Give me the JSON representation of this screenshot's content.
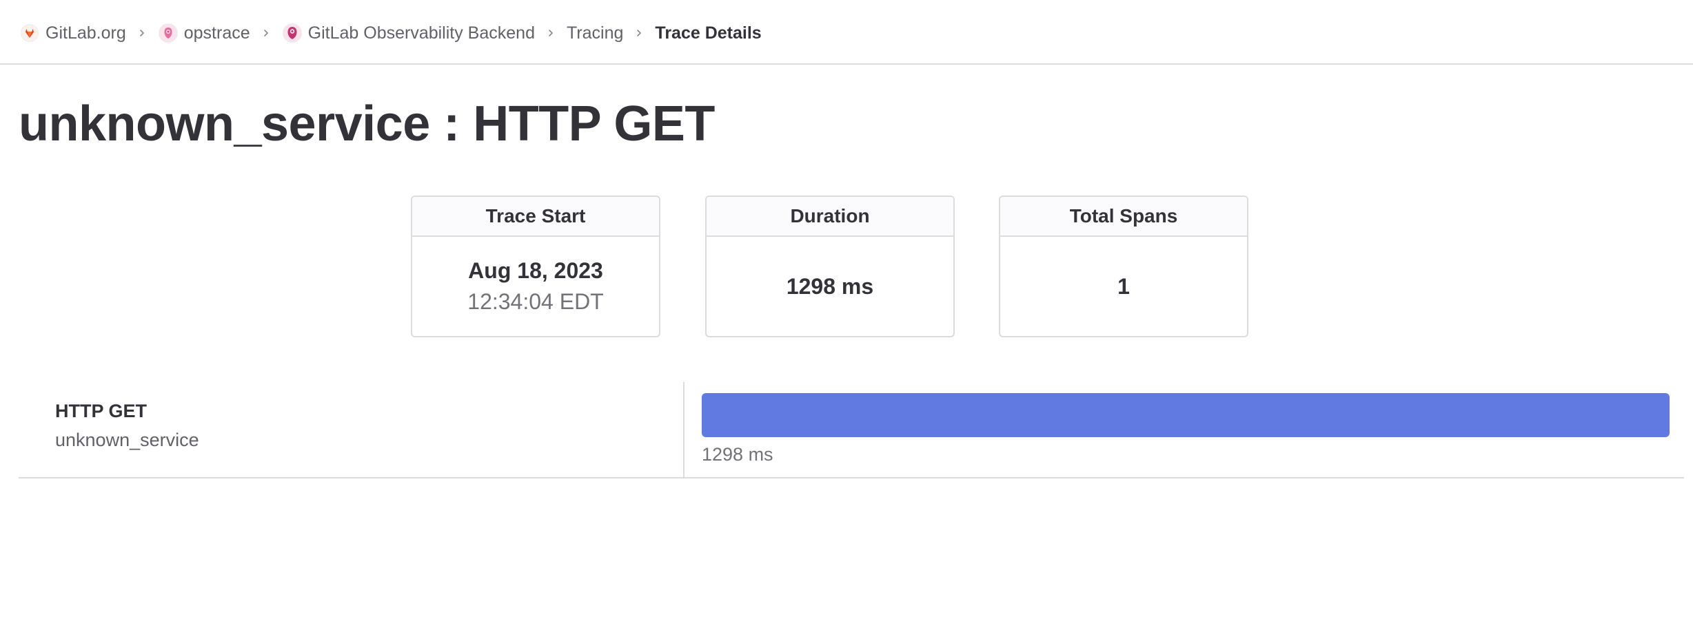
{
  "breadcrumb": {
    "items": [
      {
        "label": "GitLab.org",
        "icon": "gitlab-tanuki-icon"
      },
      {
        "label": "opstrace",
        "icon": "opstrace-avatar-icon"
      },
      {
        "label": "GitLab Observability Backend",
        "icon": "observability-avatar-icon"
      },
      {
        "label": "Tracing"
      }
    ],
    "current": "Trace Details",
    "separator_icon": "chevron-right-icon"
  },
  "title": "unknown_service : HTTP GET",
  "stats": {
    "trace_start": {
      "label": "Trace Start",
      "date": "Aug 18, 2023",
      "time": "12:34:04 EDT"
    },
    "duration": {
      "label": "Duration",
      "value": "1298 ms"
    },
    "total_spans": {
      "label": "Total Spans",
      "value": "1"
    }
  },
  "spans": [
    {
      "operation": "HTTP GET",
      "service": "unknown_service",
      "duration_label": "1298 ms",
      "start_fraction": 0,
      "length_fraction": 1,
      "color": "#617ae2"
    }
  ],
  "colors": {
    "text_primary": "#333238",
    "text_secondary": "#626168",
    "border": "#dcdcde",
    "span_bar": "#617ae2",
    "gitlab_orange": "#e24329",
    "avatar_pink": "#e05090"
  }
}
